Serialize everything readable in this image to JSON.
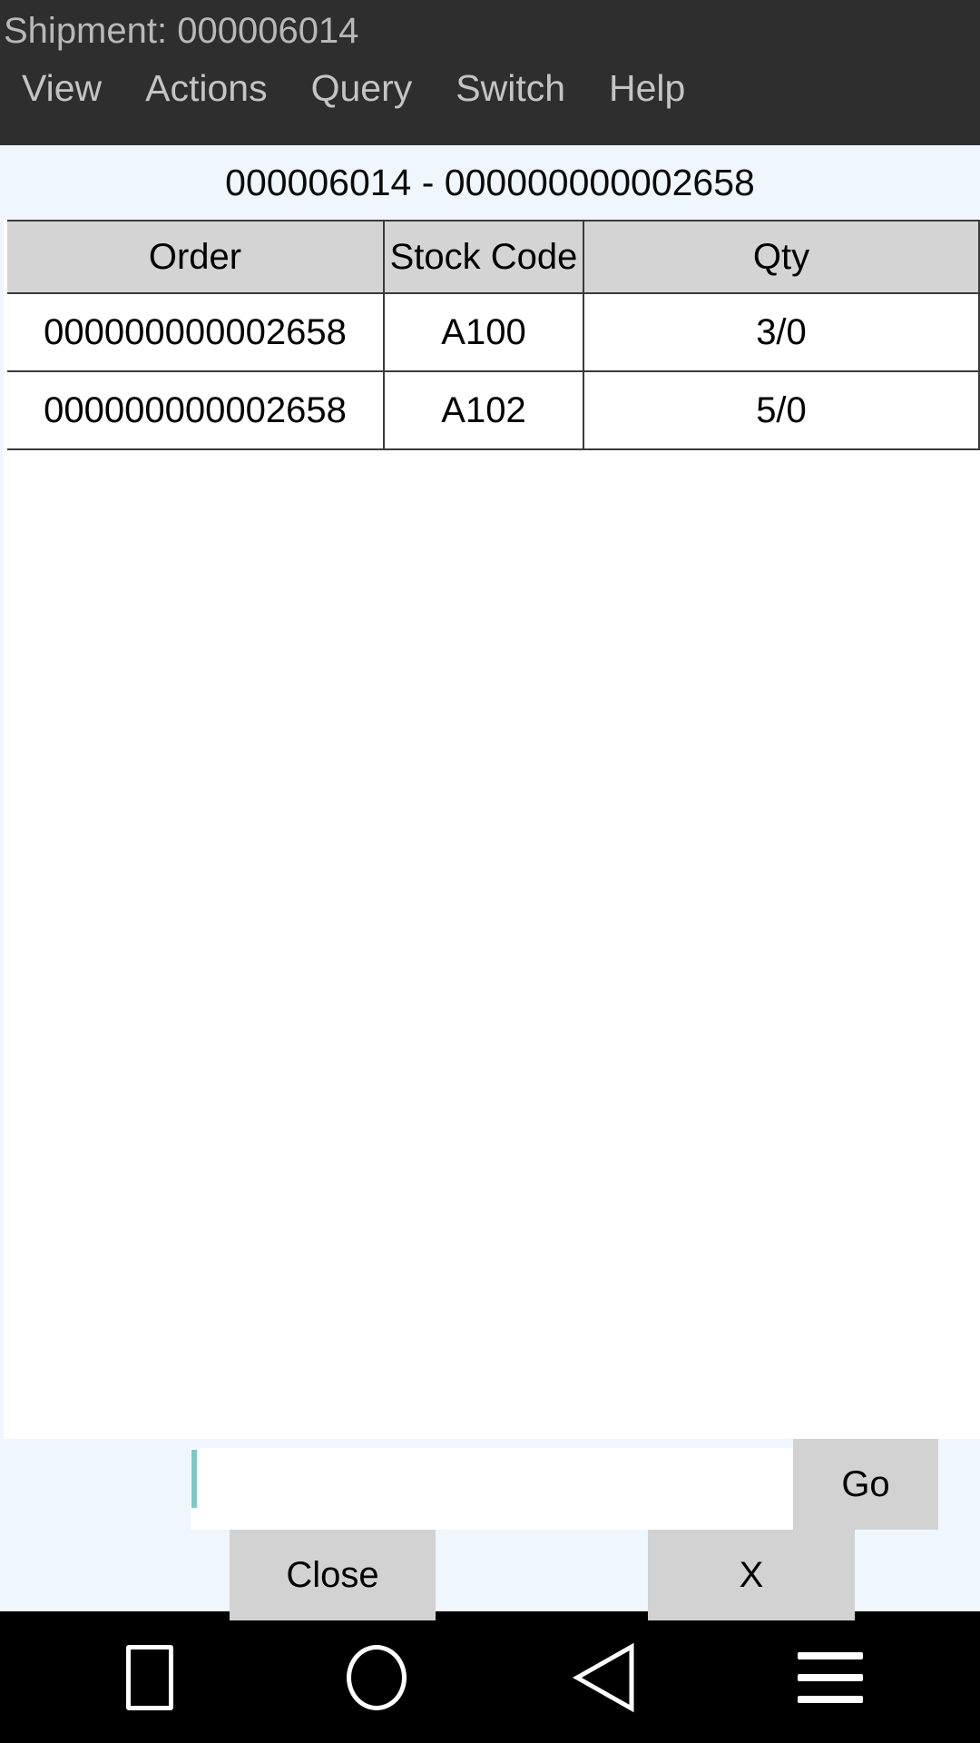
{
  "header": {
    "title": "Shipment: 000006014",
    "menu": [
      {
        "label": "View"
      },
      {
        "label": "Actions"
      },
      {
        "label": "Query"
      },
      {
        "label": "Switch"
      },
      {
        "label": "Help"
      }
    ]
  },
  "screen": {
    "title": "000006014 - 000000000002658"
  },
  "table": {
    "columns": [
      "Order",
      "Stock Code",
      "Qty"
    ],
    "rows": [
      {
        "order": "000000000002658",
        "stock_code": "A100",
        "qty": "3/0"
      },
      {
        "order": "000000000002658",
        "stock_code": "A102",
        "qty": "5/0"
      }
    ]
  },
  "bottom": {
    "input_value": "",
    "input_placeholder": "",
    "go_label": "Go",
    "close_label": "Close",
    "x_label": "X"
  },
  "navbar": {
    "recents_label": "recents",
    "home_label": "home",
    "back_label": "back",
    "menu_label": "menu"
  },
  "colors": {
    "header_bg": "#2e2e2e",
    "header_text": "#b8b8b8",
    "page_bg": "#eff6fd",
    "table_header_bg": "#d4d4d4",
    "button_bg": "#d2d2d2",
    "caret": "#7ccac4",
    "navbar_bg": "#000000"
  }
}
